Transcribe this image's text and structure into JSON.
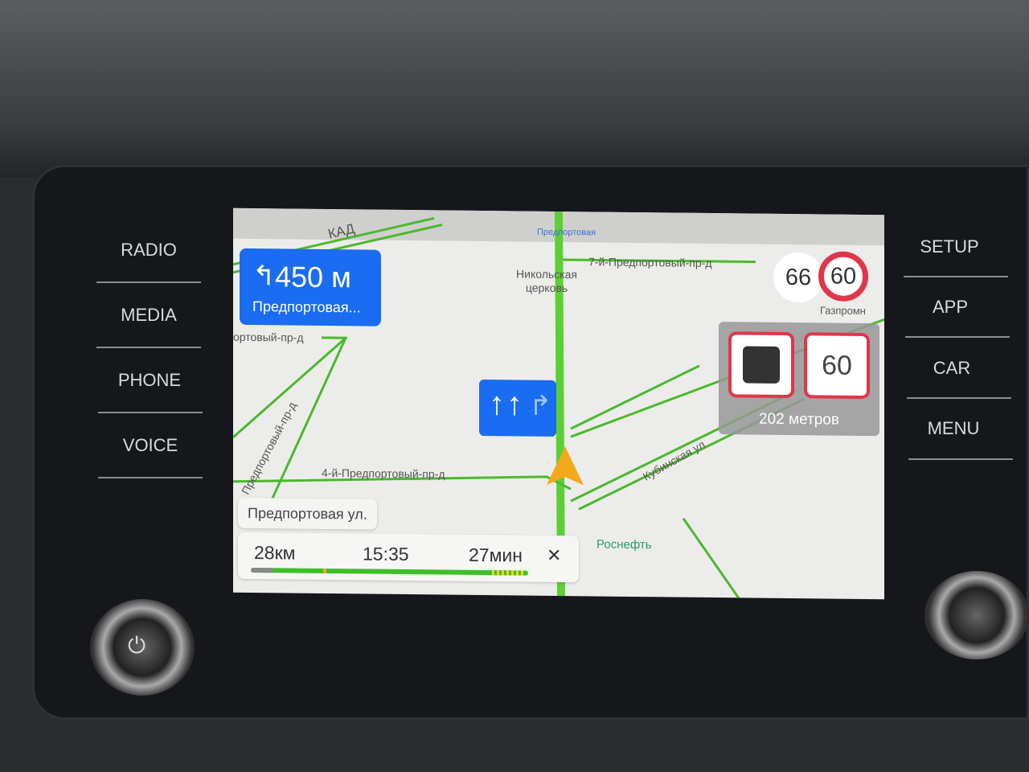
{
  "side_buttons_left": [
    {
      "label": "RADIO"
    },
    {
      "label": "MEDIA"
    },
    {
      "label": "PHONE"
    },
    {
      "label": "VOICE"
    }
  ],
  "side_buttons_right": [
    {
      "label": "SETUP"
    },
    {
      "label": "APP"
    },
    {
      "label": "CAR"
    },
    {
      "label": "MENU"
    }
  ],
  "maneuver": {
    "icon": "turn-left-icon",
    "distance": "450 м",
    "street": "Предпортовая..."
  },
  "speed": {
    "current": "66",
    "limit": "60"
  },
  "camera_warning": {
    "icon": "camera-radar-icon",
    "limit": "60",
    "distance": "202 метров"
  },
  "lanes": {
    "icons": [
      "straight-arrow-icon",
      "straight-arrow-icon",
      "right-turn-arrow-icon"
    ]
  },
  "map_labels": {
    "kad": "КАД",
    "metro": "Предпортовая",
    "church": "Никольская церковь",
    "road7": "7-й-Предпортовый-пр-д",
    "road_left": "ортовый-пр-д",
    "road_diag": "Предпортовый-пр-д",
    "road4": "4-й-Предпортовый-пр-д",
    "kubinskaya": "Кубинская ул",
    "rosneft": "Роснефть",
    "gazprom": "Газпромн"
  },
  "current_street": "Предпортовая ул.",
  "route": {
    "distance": "28км",
    "arrival": "15:35",
    "duration": "27мин",
    "close": "✕"
  },
  "colors": {
    "accent": "#1a6cf0",
    "traffic_green": "#3fbf2a",
    "limit_red": "#e0364a",
    "cursor": "#f2a91d"
  }
}
